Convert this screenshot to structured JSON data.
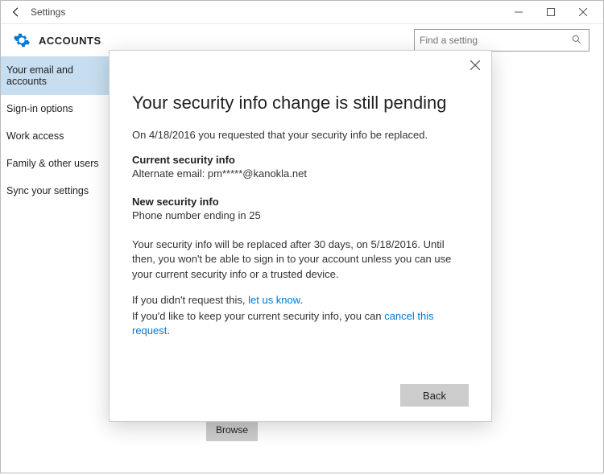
{
  "window": {
    "title": "Settings"
  },
  "header": {
    "section": "ACCOUNTS",
    "search_placeholder": "Find a setting"
  },
  "sidebar": {
    "items": [
      "Your email and accounts",
      "Sign-in options",
      "Work access",
      "Family & other users",
      "Sync your settings"
    ]
  },
  "content": {
    "browse_label": "Browse"
  },
  "modal": {
    "title": "Your security info change is still pending",
    "intro": "On 4/18/2016 you requested that your security info be replaced.",
    "current_label": "Current security info",
    "current_value": "Alternate email: pm*****@kanokla.net",
    "new_label": "New security info",
    "new_value": "Phone number ending in 25",
    "notice": "Your security info will be replaced after 30 days, on 5/18/2016. Until then, you won't be able to sign in to your account unless you can use your current security info or a trusted device.",
    "not_request_prefix": "If you didn't request this, ",
    "not_request_link": "let us know",
    "not_request_suffix": ".",
    "keep_prefix": "If you'd like to keep your current security info, you can ",
    "keep_link": "cancel this request",
    "keep_suffix": ".",
    "back_label": "Back"
  }
}
